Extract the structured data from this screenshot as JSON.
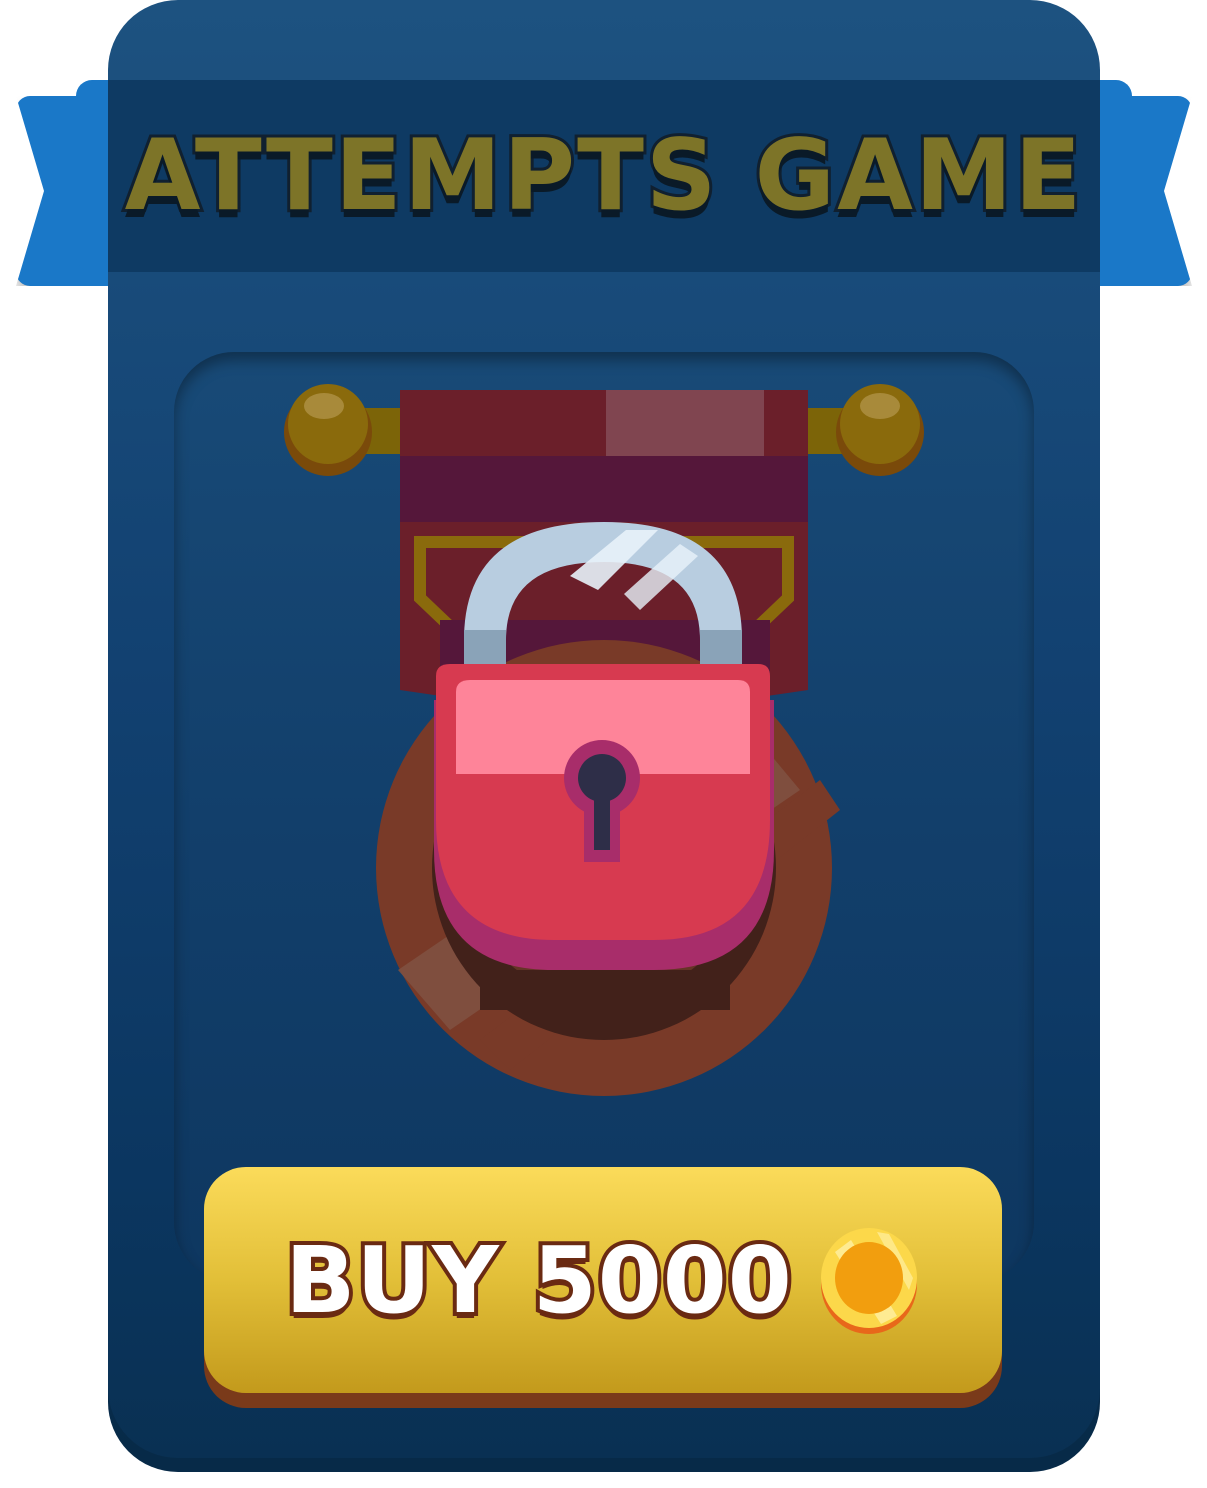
{
  "card": {
    "title": "ATTEMPTS GAME"
  },
  "lock": {
    "icon": "padlock-icon",
    "state": "locked"
  },
  "buy_button": {
    "label": "BUY 5000",
    "currency_icon": "gold-coin-icon"
  },
  "colors": {
    "card_bg": "#124171",
    "ribbon": "#1a78c8",
    "title_text": "#7d7428",
    "button": "#e2bf38",
    "lock_body": "#d73a50"
  }
}
